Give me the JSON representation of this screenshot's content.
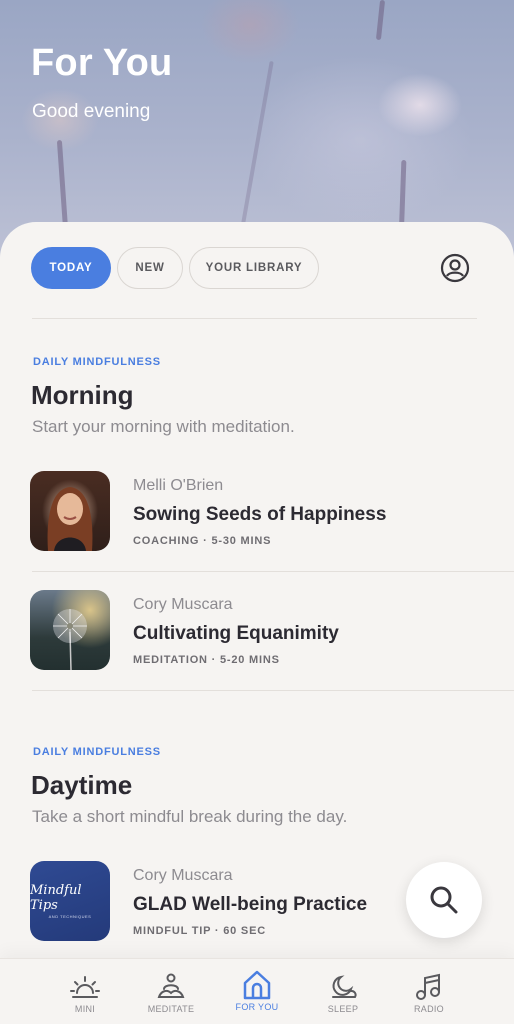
{
  "header": {
    "title": "For You",
    "subtitle": "Good evening"
  },
  "tabs": [
    {
      "label": "TODAY",
      "active": true
    },
    {
      "label": "NEW",
      "active": false
    },
    {
      "label": "YOUR LIBRARY",
      "active": false
    }
  ],
  "profile_icon": "user-circle-icon",
  "sections": [
    {
      "eyebrow": "DAILY MINDFULNESS",
      "title": "Morning",
      "description": "Start your morning with meditation.",
      "items": [
        {
          "author": "Melli O'Brien",
          "title": "Sowing Seeds of Happiness",
          "meta": "COACHING · 5-30 MINS",
          "thumb": "portrait"
        },
        {
          "author": "Cory Muscara",
          "title": "Cultivating Equanimity",
          "meta": "MEDITATION · 5-20 MINS",
          "thumb": "dandelion"
        }
      ]
    },
    {
      "eyebrow": "DAILY MINDFULNESS",
      "title": "Daytime",
      "description": "Take a short mindful break during the day.",
      "items": [
        {
          "author": "Cory Muscara",
          "title": "GLAD Well-being Practice",
          "meta": "MINDFUL TIP · 60 SEC",
          "thumb": "mindful-tips",
          "thumb_text": "Mindful Tips",
          "thumb_subtext": "AND TECHNIQUES"
        }
      ]
    }
  ],
  "search_fab_icon": "search-icon",
  "nav": [
    {
      "label": "MINI",
      "icon": "sunrise-icon",
      "active": false
    },
    {
      "label": "MEDITATE",
      "icon": "meditate-icon",
      "active": false
    },
    {
      "label": "FOR YOU",
      "icon": "home-icon",
      "active": true
    },
    {
      "label": "SLEEP",
      "icon": "moon-cloud-icon",
      "active": false
    },
    {
      "label": "RADIO",
      "icon": "music-note-icon",
      "active": false
    }
  ],
  "colors": {
    "accent": "#4a7ee0",
    "background": "#f6f4f2",
    "text_primary": "#2c2a32",
    "text_secondary": "#8d8b90"
  }
}
